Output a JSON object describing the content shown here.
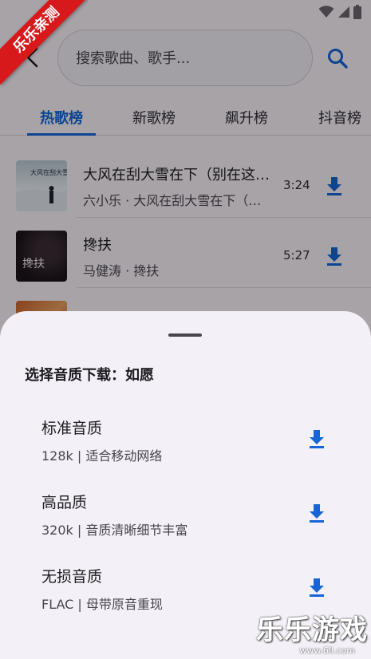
{
  "colors": {
    "accent": "#1565d8",
    "sheet_bg": "#f4f0f7",
    "ribbon_red": "#d8191b"
  },
  "status_bar": {
    "icons": [
      "wifi-icon",
      "signal-icon",
      "battery-icon"
    ]
  },
  "header": {
    "back_icon": "back-arrow-icon",
    "search_placeholder": "搜索歌曲、歌手...",
    "search_icon": "search-icon"
  },
  "tabs": [
    {
      "label": "热歌榜",
      "active": true
    },
    {
      "label": "新歌榜",
      "active": false
    },
    {
      "label": "飙升榜",
      "active": false
    },
    {
      "label": "抖音榜",
      "active": false
    }
  ],
  "songs": [
    {
      "title": "大风在刮大雪在下（别在这…",
      "subtitle": "六小乐 · 大风在刮大雪在下（…",
      "duration": "3:24",
      "cover_text": "大风在刮大雪在下"
    },
    {
      "title": "搀扶",
      "subtitle": "马健涛 · 搀扶",
      "duration": "5:27",
      "cover_text": "搀扶"
    }
  ],
  "sheet": {
    "title": "选择音质下载：如愿",
    "options": [
      {
        "name": "标准音质",
        "desc": "128k | 适合移动网络"
      },
      {
        "name": "高品质",
        "desc": "320k | 音质清晰细节丰富"
      },
      {
        "name": "无损音质",
        "desc": "FLAC | 母带原音重现"
      }
    ]
  },
  "watermark": {
    "ribbon": "乐乐亲测",
    "brand": "乐乐游戏",
    "brand_url": "www.6ll.com"
  }
}
